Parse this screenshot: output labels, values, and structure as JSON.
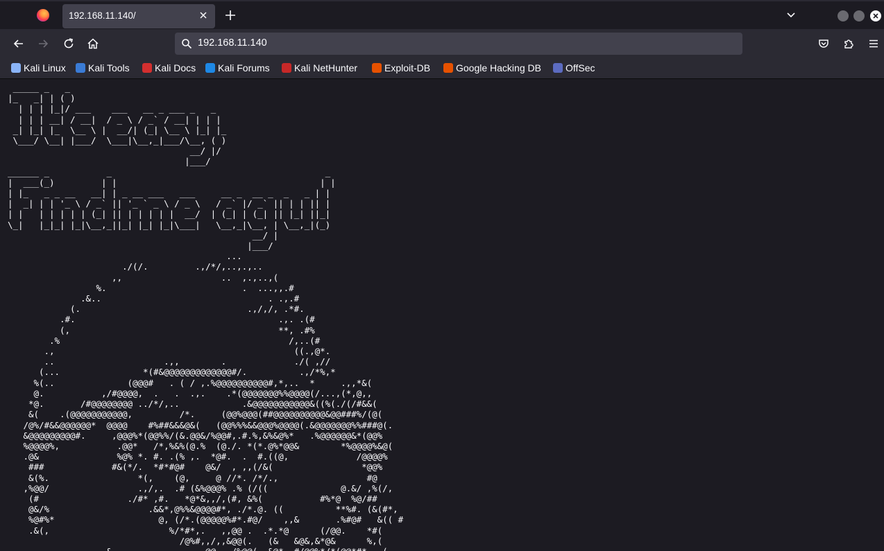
{
  "browser": {
    "tab": {
      "title": "192.168.11.140/"
    },
    "url": "192.168.11.140",
    "icons": [
      "firefox-icon",
      "close-icon",
      "plus-icon",
      "chevron-down-icon",
      "back-icon",
      "forward-icon",
      "reload-icon",
      "home-icon",
      "search-icon",
      "pocket-icon",
      "extensions-icon",
      "menu-icon"
    ]
  },
  "bookmarks": [
    {
      "label": "Kali Linux",
      "color": "#8ab4f8"
    },
    {
      "label": "Kali Tools",
      "color": "#3a7bd5"
    },
    {
      "label": "Kali Docs",
      "color": "#d32f2f"
    },
    {
      "label": "Kali Forums",
      "color": "#1e88e5"
    },
    {
      "label": "Kali NetHunter",
      "color": "#c62828"
    },
    {
      "label": "Exploit-DB",
      "color": "#e65100"
    },
    {
      "label": "Google Hacking DB",
      "color": "#e65100"
    },
    {
      "label": "OffSec",
      "color": "#5c6bc0"
    }
  ],
  "page": {
    "ascii_art": " _____ _   _\n|_   _| | ( )\n  | | | |_|/ ___    ___   __ _ ___ _   _\n  | | | __| / __|  / _ \\ / _` / __| | | |\n _| |_| |_  \\__ \\ |  __/| (_| \\__ \\ |_| |_\n \\___/ \\__| |___/  \\___|\\__,_|___/\\__, ( )\n                                   __/ |/\n                                  |___/\n______ _           _                                         _\n|  ___(_)         | |                                       | |\n| |_   _ _ __   __| | _ __ ___   ___     __ _  __ _  _   _ | |\n|  _| | | '_ \\ / _` || '_ ` _ \\ / _ \\   / _` |/ _` || | | || |\n| |   | | | | | (_| || | | | | |  __/  | (_| | (_| || |_| ||_|\n\\_|   |_|_| |_|\\__,_||_| |_| |_|\\___|   \\__,_|\\__, | \\__,_|(_)\n                                               __/ |\n                                              |___/\n                                          ...\n                      ./(/.         .,/*/,..,.,..\n                    ,,                   ..  ,.,..,(\n                 %.                          .  ...,,.#\n              .&..                                . .,.#\n            (.                                .,/,/, .*#.\n          .#.                                       .,. .(#\n          (,                                        **, .#%\n        .%                                            /,..(#\n       .,                                              ((.,@*.\n       ..                     .,,        .             ./( ,//\n      (...                *(#&@@@@@@@@@@@@@#/.          .,/*%,*\n     %(..              (@@@#   . ( / ,.%@@@@@@@@@@#,*,..  *     .,,*&(\n     @.           ,/#@@@@,  .   .  .,.    .*(@@@@@@@%%@@@@(/...,(*,@,,\n    *@.       /#@@@@@@@@ ../*/,..            .&@@@@@@@@@@@&((%(./(/#&&(\n    &(    .(@@@@@@@@@@@,         /*.     (@@%@@@(##@@@@@@@@@@&@@###%/(@(\n   /@%/#&&@@@@@@*  @@@@    #%##&&&@&(   (@@%%%&&@@@%@@@@(.&@@@@@@@%%###@(.\n   &@@@@@@@@@#.     ,@@@%*(@@%%/(&.@@&/%@@#,.#.%,&%&@%*   .%@@@@@@&*(@@%\n   %@@@@%,           .@@*   /*,%&%(@.%  (@./. *(*.@%*@@&        *%@@@@%&@(\n   .@&               %@% *. #. .(% ,.  *@#.  .  #.((@,             /@@@@%\n    ###             #&(*/.  *#*#@#    @&/  , ,,(/&(                 *@@%\n    &(%.                 *(,    (@,     @ //*. /*/.,                 #@\n   ,%@@/                 .,/,.  .# (&%@@@% .% (/((              @.&/ ,%(/,\n    (#                 ./#* ,#.   *@*&,,/,(#, &%(           #%*@  %@/##\n    @&/%                   .&&*,@%%&@@@@#*, ./*.@. ((          **%#. (&(#*,\n    %@#%*                    @, (/*.(@@@@@%#*.#@/    ,,&       .%#@#   &(( #\n    .&(,                       %/*#*,.   ,,@@ .  .*.*@      (/@@.    *#(\n                                 /@%#,,/,,&@@(.   (&   &@&,&*@&      %,(\n                  ,&                  @@   /%@@(  &@*  #/@@%*/*(@@*#*  .(\n"
  }
}
